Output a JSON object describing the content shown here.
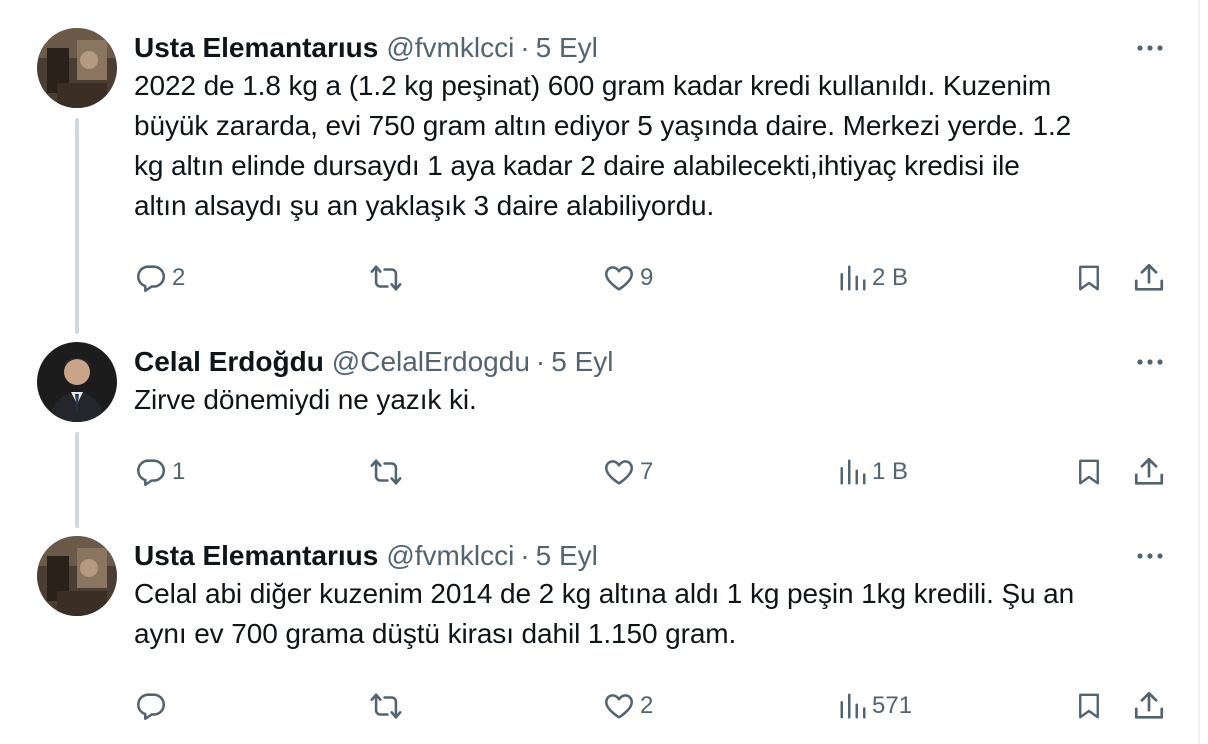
{
  "tweets": [
    {
      "name": "Usta Elemantarıus",
      "handle": "@fvmklcci",
      "separator": "·",
      "date": "5 Eyl",
      "lines": [
        "2022 de 1.8 kg a (1.2 kg peşinat) 600 gram kadar kredi kullanıldı. Kuzenim",
        "büyük zararda, evi 750 gram altın ediyor 5 yaşında daire. Merkezi yerde. 1.2",
        "kg altın elinde dursaydı 1 aya kadar 2 daire alabilecekti,ihtiyaç kredisi ile",
        "altın alsaydı şu an yaklaşık 3 daire alabiliyordu."
      ],
      "replies": "2",
      "retweets": "",
      "likes": "9",
      "views": "2 B",
      "avatar_icon": "user-avatar-photo"
    },
    {
      "name": "Celal Erdoğdu",
      "handle": "@CelalErdogdu",
      "separator": "·",
      "date": "5 Eyl",
      "lines": [
        "Zirve dönemiydi ne yazık ki."
      ],
      "replies": "1",
      "retweets": "",
      "likes": "7",
      "views": "1 B",
      "avatar_icon": "user-avatar-photo"
    },
    {
      "name": "Usta Elemantarıus",
      "handle": "@fvmklcci",
      "separator": "·",
      "date": "5 Eyl",
      "lines": [
        "Celal abi diğer kuzenim 2014 de 2 kg altına aldı 1 kg peşin 1kg kredili. Şu an",
        "aynı ev 700 grama düştü kirası dahil 1.150 gram."
      ],
      "replies": "",
      "retweets": "",
      "likes": "2",
      "views": "571",
      "avatar_icon": "user-avatar-photo"
    }
  ],
  "icons": {
    "reply": "reply-icon",
    "retweet": "retweet-icon",
    "like": "heart-icon",
    "views": "views-chart-icon",
    "bookmark": "bookmark-icon",
    "share": "share-icon",
    "more": "more-options-icon"
  },
  "colors": {
    "text": "#0f1419",
    "secondary": "#536471",
    "thread_line": "#cfd9de"
  }
}
